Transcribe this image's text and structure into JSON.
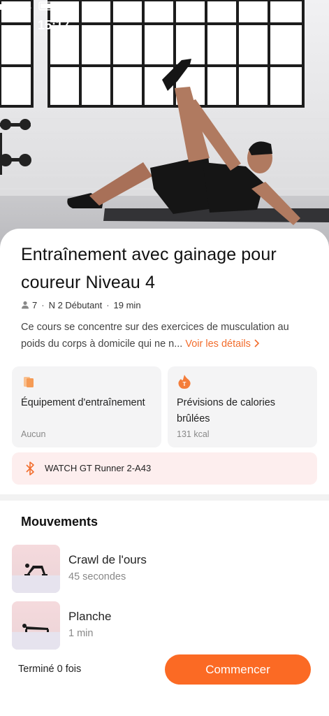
{
  "status_bar": {
    "time": "15:17"
  },
  "workout": {
    "title": "Entraînement avec gainage pour coureur Niveau 4",
    "participants": "7",
    "level": "N 2 Débutant",
    "duration": "19 min",
    "description": "Ce cours se concentre sur des exercices de musculation au poids du corps à domicile qui ne n...",
    "details_link": "Voir les détails"
  },
  "cards": {
    "equipment": {
      "title": "Équipement d'entraînement",
      "value": "Aucun",
      "icon": "equipment-icon",
      "color": "#f7a15f"
    },
    "calories": {
      "title": "Prévisions de calories brûlées",
      "value": "131 kcal",
      "icon": "calorie-icon",
      "color": "#f47d3a"
    }
  },
  "device": {
    "name": "WATCH GT Runner 2-A43",
    "icon": "bluetooth-icon"
  },
  "movements": {
    "title": "Mouvements",
    "items": [
      {
        "name": "Crawl de l'ours",
        "duration": "45 secondes"
      },
      {
        "name": "Planche",
        "duration": "1 min"
      }
    ]
  },
  "footer": {
    "completed": "Terminé 0 fois",
    "start_label": "Commencer"
  },
  "colors": {
    "accent": "#fb6a24",
    "link": "#f26d2d",
    "card_bg": "#f4f4f5",
    "device_bg": "#fdeeee"
  }
}
